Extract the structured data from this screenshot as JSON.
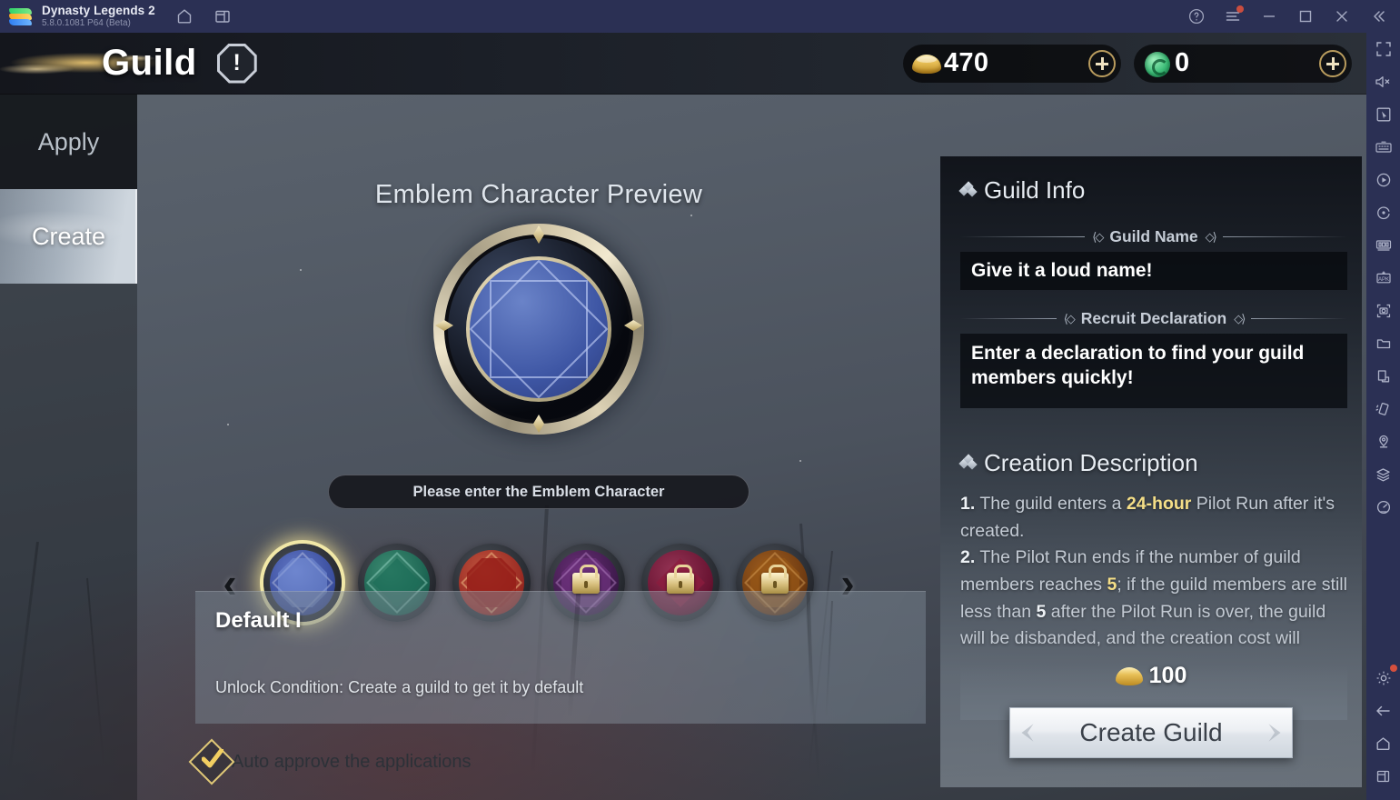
{
  "titlebar": {
    "app_name": "Dynasty Legends 2",
    "version": "5.8.0.1081 P64 (Beta)",
    "icons": [
      "bluestacks-logo",
      "home-icon",
      "multi-instance-icon"
    ],
    "right_icons": [
      "help-icon",
      "menu-icon",
      "minimize-icon",
      "maximize-icon",
      "close-icon",
      "collapse-icon"
    ]
  },
  "game_top": {
    "title": "Guild",
    "info_icon": "exclamation-octagon-icon",
    "currencies": [
      {
        "id": "gold",
        "icon": "gold-ingot-icon",
        "value": "470",
        "add": "+"
      },
      {
        "id": "jade",
        "icon": "jade-coin-icon",
        "value": "0",
        "add": "+"
      }
    ]
  },
  "sidebar": {
    "items": [
      {
        "label": "Apply",
        "active": false
      },
      {
        "label": "Create",
        "active": true
      }
    ]
  },
  "center": {
    "preview_title": "Emblem Character Preview",
    "emblem_input_placeholder": "Please enter the Emblem Character",
    "prev_arrow": "‹",
    "next_arrow": "›",
    "emblems": [
      {
        "id": "default-1",
        "color": "#4a5fae",
        "selected": true,
        "locked": false
      },
      {
        "id": "emblem-2",
        "color": "#1d6a5a",
        "selected": false,
        "locked": false
      },
      {
        "id": "emblem-3",
        "color": "#9d2a23",
        "selected": false,
        "locked": false
      },
      {
        "id": "emblem-4",
        "color": "#5a2466",
        "selected": false,
        "locked": true
      },
      {
        "id": "emblem-5",
        "color": "#7a1b46",
        "selected": false,
        "locked": true
      },
      {
        "id": "emblem-6",
        "color": "#8a4a16",
        "selected": false,
        "locked": true
      }
    ],
    "emblem_detail": {
      "name": "Default I",
      "unlock": "Unlock Condition: Create a guild to get it by default"
    },
    "auto_approve": {
      "label": "Auto approve the applications",
      "checked": true
    }
  },
  "right_panel": {
    "guild_info_heading": "Guild Info",
    "guild_name_label": "Guild Name",
    "guild_name_value": "Give it a loud name!",
    "recruit_label": "Recruit Declaration",
    "recruit_value": "Enter a declaration to find your guild members quickly!",
    "creation_heading": "Creation Description",
    "desc_line_1_num": "1.",
    "desc_line_1_a": " The guild enters a ",
    "desc_line_1_hl": "24-hour",
    "desc_line_1_b": " Pilot Run after it's created.",
    "desc_line_2_num": "2.",
    "desc_line_2_a": " The Pilot Run ends if the number of guild members reaches ",
    "desc_line_2_hl1": "5",
    "desc_line_2_b": "; if the guild members are still less than ",
    "desc_line_2_hl2": "5",
    "desc_line_2_c": " after the Pilot Run is over, the guild will be disbanded, and the creation cost will",
    "cost_icon": "gold-ingot-icon",
    "cost_value": "100",
    "create_button": "Create Guild"
  },
  "rail": {
    "icons": [
      "fullscreen-icon",
      "mute-icon",
      "pointer-icon",
      "keyboard-icon",
      "macro-record-icon",
      "rotate-icon",
      "multi-instance-manager-icon",
      "install-apk-icon",
      "screenshot-icon",
      "media-folder-icon",
      "copy-to-pc-icon",
      "shake-icon",
      "location-icon",
      "layers-icon",
      "performance-icon"
    ],
    "bottom_icons": [
      "settings-gear-icon",
      "back-icon",
      "home-icon",
      "recents-icon"
    ]
  },
  "colors": {
    "accent_gold": "#f4de87",
    "bluestacks_bg": "#2b3054",
    "notification_dot": "#f4553a"
  }
}
